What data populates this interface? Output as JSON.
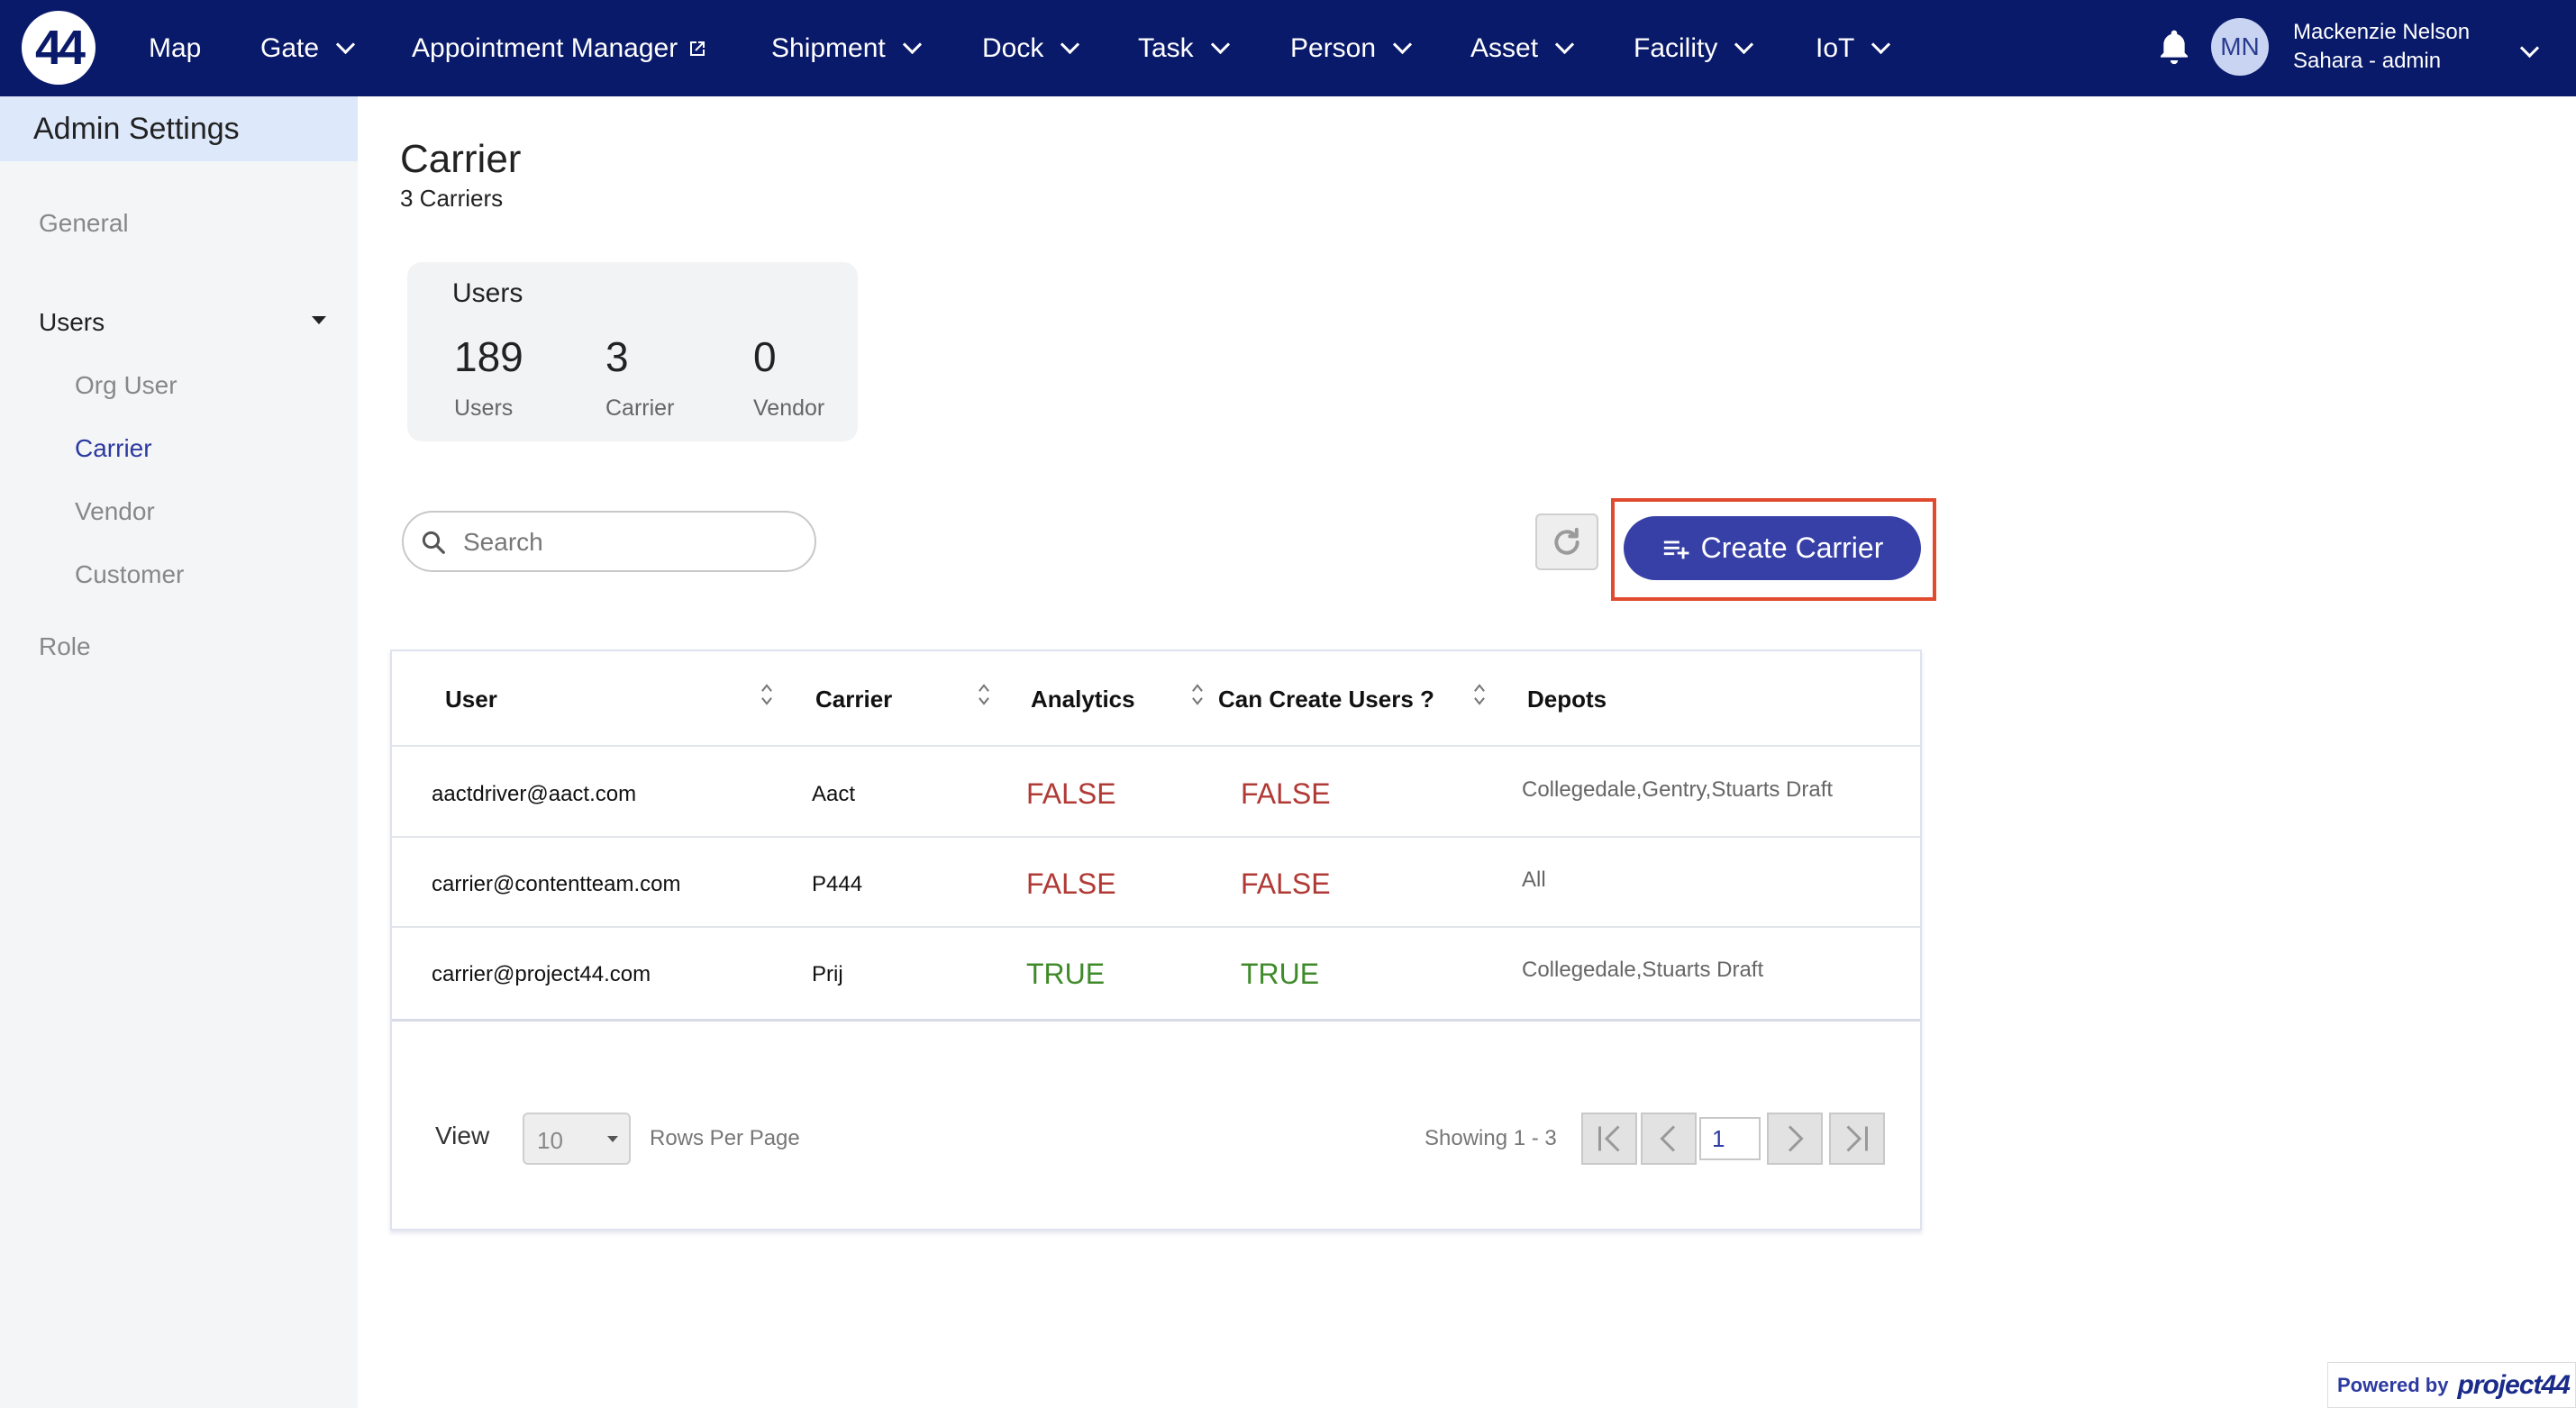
{
  "nav": {
    "logo": "44",
    "items": [
      {
        "label": "Map",
        "has_dropdown": false
      },
      {
        "label": "Gate",
        "has_dropdown": true
      },
      {
        "label": "Appointment Manager",
        "has_dropdown": false,
        "icon": "external-link-icon"
      },
      {
        "label": "Shipment",
        "has_dropdown": true
      },
      {
        "label": "Dock",
        "has_dropdown": true
      },
      {
        "label": "Task",
        "has_dropdown": true
      },
      {
        "label": "Person",
        "has_dropdown": true
      },
      {
        "label": "Asset",
        "has_dropdown": true
      },
      {
        "label": "Facility",
        "has_dropdown": true
      },
      {
        "label": "IoT",
        "has_dropdown": true
      }
    ],
    "user": {
      "initials": "MN",
      "name": "Mackenzie Nelson",
      "org": "Sahara - admin"
    }
  },
  "sidebar": {
    "title": "Admin Settings",
    "general": "General",
    "users": "Users",
    "sub_items": [
      "Org User",
      "Carrier",
      "Vendor",
      "Customer"
    ],
    "active": "Carrier",
    "role": "Role"
  },
  "page": {
    "title": "Carrier",
    "subtitle": "3 Carriers"
  },
  "stats": {
    "title": "Users",
    "items": [
      {
        "value": "189",
        "label": "Users"
      },
      {
        "value": "3",
        "label": "Carrier"
      },
      {
        "value": "0",
        "label": "Vendor"
      }
    ]
  },
  "search": {
    "placeholder": "Search",
    "value": ""
  },
  "actions": {
    "create_label": "Create Carrier"
  },
  "table": {
    "headers": [
      "User",
      "Carrier",
      "Analytics",
      "Can Create Users ?",
      "Depots"
    ],
    "rows": [
      {
        "user": "aactdriver@aact.com",
        "carrier": "Aact",
        "analytics": "FALSE",
        "can_create": "FALSE",
        "depots": "Collegedale,Gentry,Stuarts Draft"
      },
      {
        "user": "carrier@contentteam.com",
        "carrier": "P444",
        "analytics": "FALSE",
        "can_create": "FALSE",
        "depots": "All"
      },
      {
        "user": "carrier@project44.com",
        "carrier": "Prij",
        "analytics": "TRUE",
        "can_create": "TRUE",
        "depots": "Collegedale,Stuarts Draft"
      }
    ]
  },
  "pagination": {
    "view_label": "View",
    "rows_per_page": "10",
    "rows_per_page_label": "Rows Per Page",
    "showing": "Showing 1 - 3",
    "current_page": "1"
  },
  "footer": {
    "powered_by": "Powered by",
    "brand": "project44"
  },
  "colors": {
    "nav_bg": "#0a1a6a",
    "primary": "#3740a6",
    "false": "#b03a36",
    "true": "#3f8a2a",
    "highlight": "#e04a2f"
  }
}
